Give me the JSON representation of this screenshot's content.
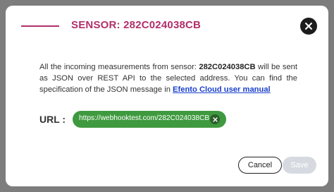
{
  "modal": {
    "title": "SENSOR: 282C024038CB",
    "description": {
      "part1": "All the incoming measurements from sensor: ",
      "sensor_id": "282C024038CB",
      "part2": " will be sent as JSON over REST API to the selected address. You can find the specification of the JSON message in ",
      "link_text": "Efento Cloud user manual"
    },
    "url_label": "URL :",
    "url_value": "https://webhooktest.com/282C024038CB",
    "buttons": {
      "cancel": "Cancel",
      "save": "Save"
    },
    "colors": {
      "accent": "#b0306a",
      "chip": "#3f9a3f",
      "link": "#1a3fcc",
      "save_disabled": "#d6dae0"
    },
    "icons": {
      "close": "close-icon",
      "chip_remove": "remove-url-icon"
    }
  }
}
